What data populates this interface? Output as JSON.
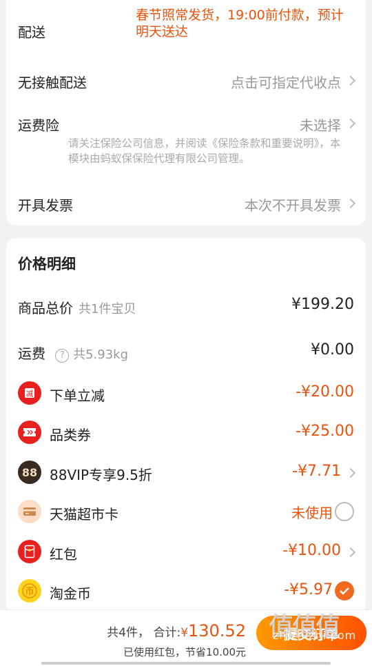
{
  "delivery": {
    "shipping_label": "配送",
    "shipping_note": "春节照常发货，19:00前付款，预计明天送达",
    "contactless_label": "无接触配送",
    "contactless_value": "点击可指定代收点",
    "insurance_label": "运费险",
    "insurance_value": "未选择",
    "insurance_note": "请关注保险公司信息，并阅读《保险条款和重要说明》，本模块由蚂蚁保保险代理有限公司管理。",
    "invoice_label": "开具发票",
    "invoice_value": "本次不开具发票"
  },
  "price_detail": {
    "title": "价格明细",
    "goods_total_label": "商品总价",
    "goods_total_count": "共1件宝贝",
    "goods_total_value": "¥199.20",
    "freight_label": "运费",
    "freight_weight": "共5.93kg",
    "freight_value": "¥0.00",
    "discounts": [
      {
        "label": "下单立减",
        "value": "-¥20.00",
        "icon": "reduce-icon"
      },
      {
        "label": "品类券",
        "value": "-¥25.00",
        "icon": "coupon-icon"
      },
      {
        "label": "88VIP专享9.5折",
        "value": "-¥7.71",
        "icon": "vip-88-icon",
        "icon_text": "88"
      },
      {
        "label": "天猫超市卡",
        "value": "未使用",
        "icon": "card-icon"
      },
      {
        "label": "红包",
        "value": "-¥10.00",
        "icon": "red-packet-icon"
      },
      {
        "label": "淘金币",
        "value": "-¥5.97",
        "icon": "gold-coin-icon"
      }
    ]
  },
  "bottom": {
    "count_text": "共4件，",
    "total_label": "合计:",
    "currency": "¥",
    "total_amount": "130.52",
    "saved_text": "已使用红包，节省10.00元",
    "submit_label": "提交订单"
  },
  "watermark": {
    "text": "zhizhizhi.com",
    "logo": "值值值"
  },
  "colors": {
    "accent": "#e8540f",
    "button_start": "#ff9a00",
    "button_end": "#ff5000"
  }
}
